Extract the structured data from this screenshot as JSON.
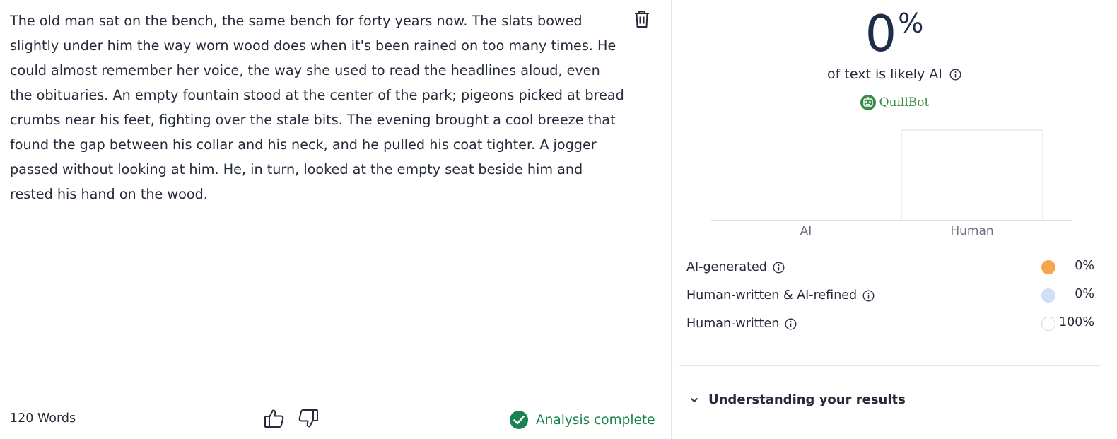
{
  "editor": {
    "text": "The old man sat on the bench, the same bench for forty years now. The slats bowed slightly under him the way worn wood does when it's been rained on too many times. He could almost remember her voice, the way she used to read the headlines aloud, even the obituaries. An empty fountain stood at the center of the park; pigeons picked at bread crumbs near his feet, fighting over the stale bits. The evening brought a cool breeze that found the gap between his collar and his neck, and he pulled his coat tighter. A jogger passed without looking at him. He, in turn, looked at the empty seat beside him and rested his hand on the wood.",
    "delete_icon": "trash-icon",
    "word_count": "120 Words",
    "feedback": {
      "up_icon": "thumbs-up-icon",
      "down_icon": "thumbs-down-icon"
    },
    "status": {
      "label": "Analysis complete",
      "icon": "check-circle-icon",
      "color": "#188251"
    }
  },
  "results": {
    "score_value": "0",
    "score_unit": "%",
    "score_caption": "of text is likely AI",
    "brand": "QuillBot",
    "chart_data": {
      "type": "bar",
      "categories": [
        "AI",
        "Human"
      ],
      "values": [
        0,
        100
      ],
      "ylim": [
        0,
        100
      ],
      "title": "",
      "xlabel": "",
      "ylabel": ""
    },
    "legend": [
      {
        "label": "AI-generated",
        "value": "0%",
        "color": "#f5a54a"
      },
      {
        "label": "Human-written & AI-refined",
        "value": "0%",
        "color": "#cfe0f6"
      },
      {
        "label": "Human-written",
        "value": "100%",
        "color": "#ffffff"
      }
    ],
    "understanding_label": "Understanding your results",
    "colors": {
      "accent": "#188251",
      "score": "#1f2c4a",
      "text": "#252b3a"
    }
  }
}
